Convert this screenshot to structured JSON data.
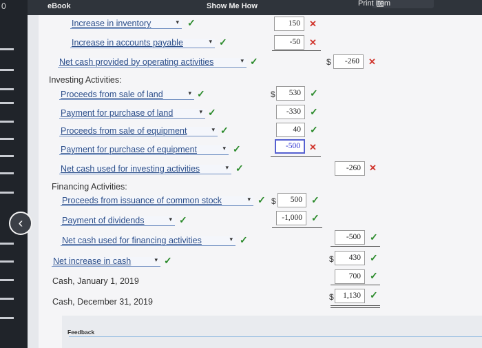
{
  "window": {
    "back_number": "0"
  },
  "topbar": {
    "ebook_label": "eBook",
    "show_me_how_label": "Show Me How",
    "print_label": "Print Item"
  },
  "operating": {
    "items": [
      {
        "label": "Increase in inventory",
        "value": "150",
        "mark": "x"
      },
      {
        "label": "Increase in accounts payable",
        "value": "-50",
        "mark": "x"
      }
    ],
    "net_label": "Net cash provided by operating activities",
    "net_value": "-260",
    "net_mark": "x"
  },
  "investing": {
    "heading": "Investing Activities:",
    "items": [
      {
        "label": "Proceeds from sale of land",
        "value": "530",
        "mark": "check"
      },
      {
        "label": "Payment for purchase of land",
        "value": "-330",
        "mark": "check"
      },
      {
        "label": "Proceeds from sale of equipment",
        "value": "40",
        "mark": "check"
      },
      {
        "label": "Payment for purchase of equipment",
        "value": "-500",
        "mark": "x"
      }
    ],
    "net_label": "Net cash used for investing activities",
    "net_value": "-260",
    "net_mark": "x"
  },
  "financing": {
    "heading": "Financing Activities:",
    "items": [
      {
        "label": "Proceeds from issuance of common stock",
        "value": "500",
        "mark": "check"
      },
      {
        "label": "Payment of dividends",
        "value": "-1,000",
        "mark": "check"
      }
    ],
    "net_label": "Net cash used for financing activities",
    "net_value": "-500",
    "net_mark": "check"
  },
  "summary": {
    "net_increase_label": "Net increase in cash",
    "net_increase_value": "430",
    "cash_jan_label": "Cash, January 1, 2019",
    "cash_jan_value": "700",
    "cash_dec_label": "Cash, December 31, 2019",
    "cash_dec_value": "1,130"
  },
  "currency_symbol": "$",
  "feedback_label": "Feedback",
  "glyphs": {
    "check": "✓",
    "x": "✕",
    "caret": "▾",
    "back": "‹"
  },
  "colors": {
    "check": "#2a8a2a",
    "x": "#d0342c",
    "focus_border": "#5560d0"
  }
}
